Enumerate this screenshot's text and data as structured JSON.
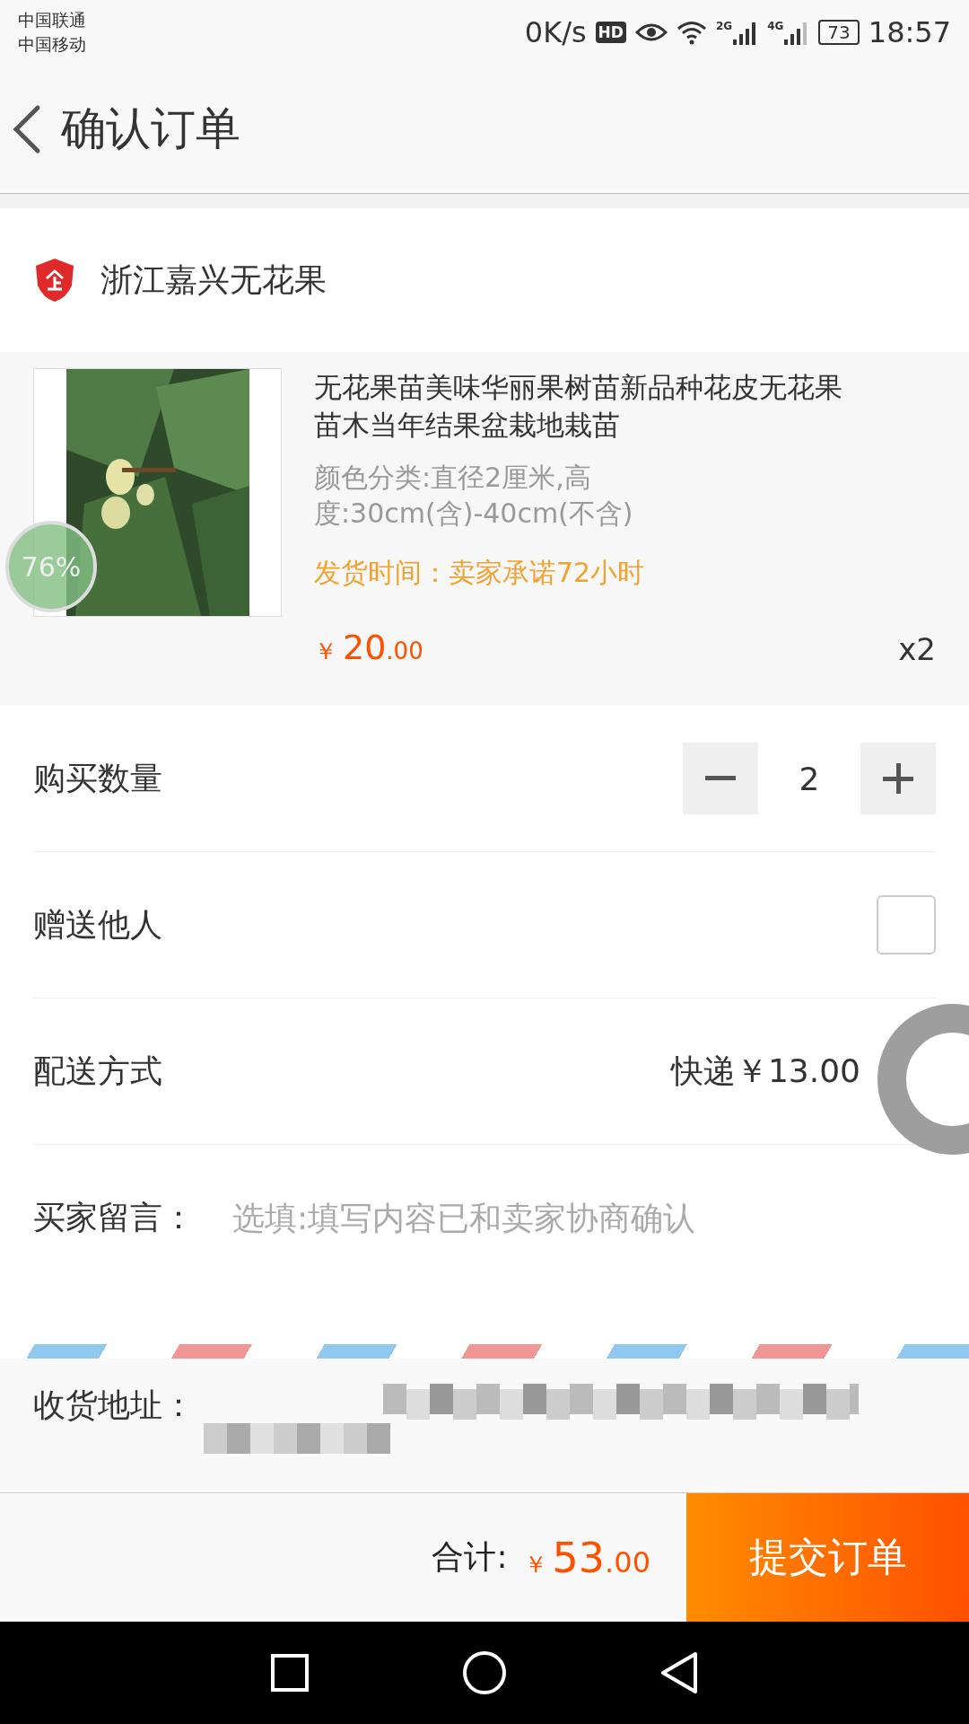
{
  "status_bar": {
    "carriers": [
      "中国联通",
      "中国移动"
    ],
    "speed": "0K/s",
    "hd": "HD",
    "networks": [
      "2G",
      "4G"
    ],
    "battery": "73",
    "time": "18:57"
  },
  "header": {
    "title": "确认订单"
  },
  "shop": {
    "name": "浙江嘉兴无花果"
  },
  "product": {
    "title": "无花果苗美味华丽果树苗新品种花皮无花果苗木当年结果盆栽地栽苗",
    "spec": "颜色分类:直径2厘米,高度:30cm(含)-40cm(不含)",
    "ship_time": "发货时间：卖家承诺72小时",
    "currency": "￥",
    "price_int": "20",
    "price_dec": ".00",
    "quantity": "x2"
  },
  "rows": [
    {
      "kind": "stepper",
      "label": "购买数量",
      "value": "2"
    },
    {
      "kind": "checkbox",
      "label": "赠送他人",
      "checked": false
    },
    {
      "kind": "value",
      "label": "配送方式",
      "value": "快递￥13.00"
    },
    {
      "kind": "input",
      "label": "买家留言：",
      "placeholder": "选填:填写内容已和卖家协商确认"
    }
  ],
  "address": {
    "label": "收货地址："
  },
  "footer": {
    "total_label": "合计:",
    "currency": "￥",
    "total_int": "53",
    "total_dec": ".00",
    "submit": "提交订单"
  },
  "overlay": {
    "percent": "76%"
  }
}
